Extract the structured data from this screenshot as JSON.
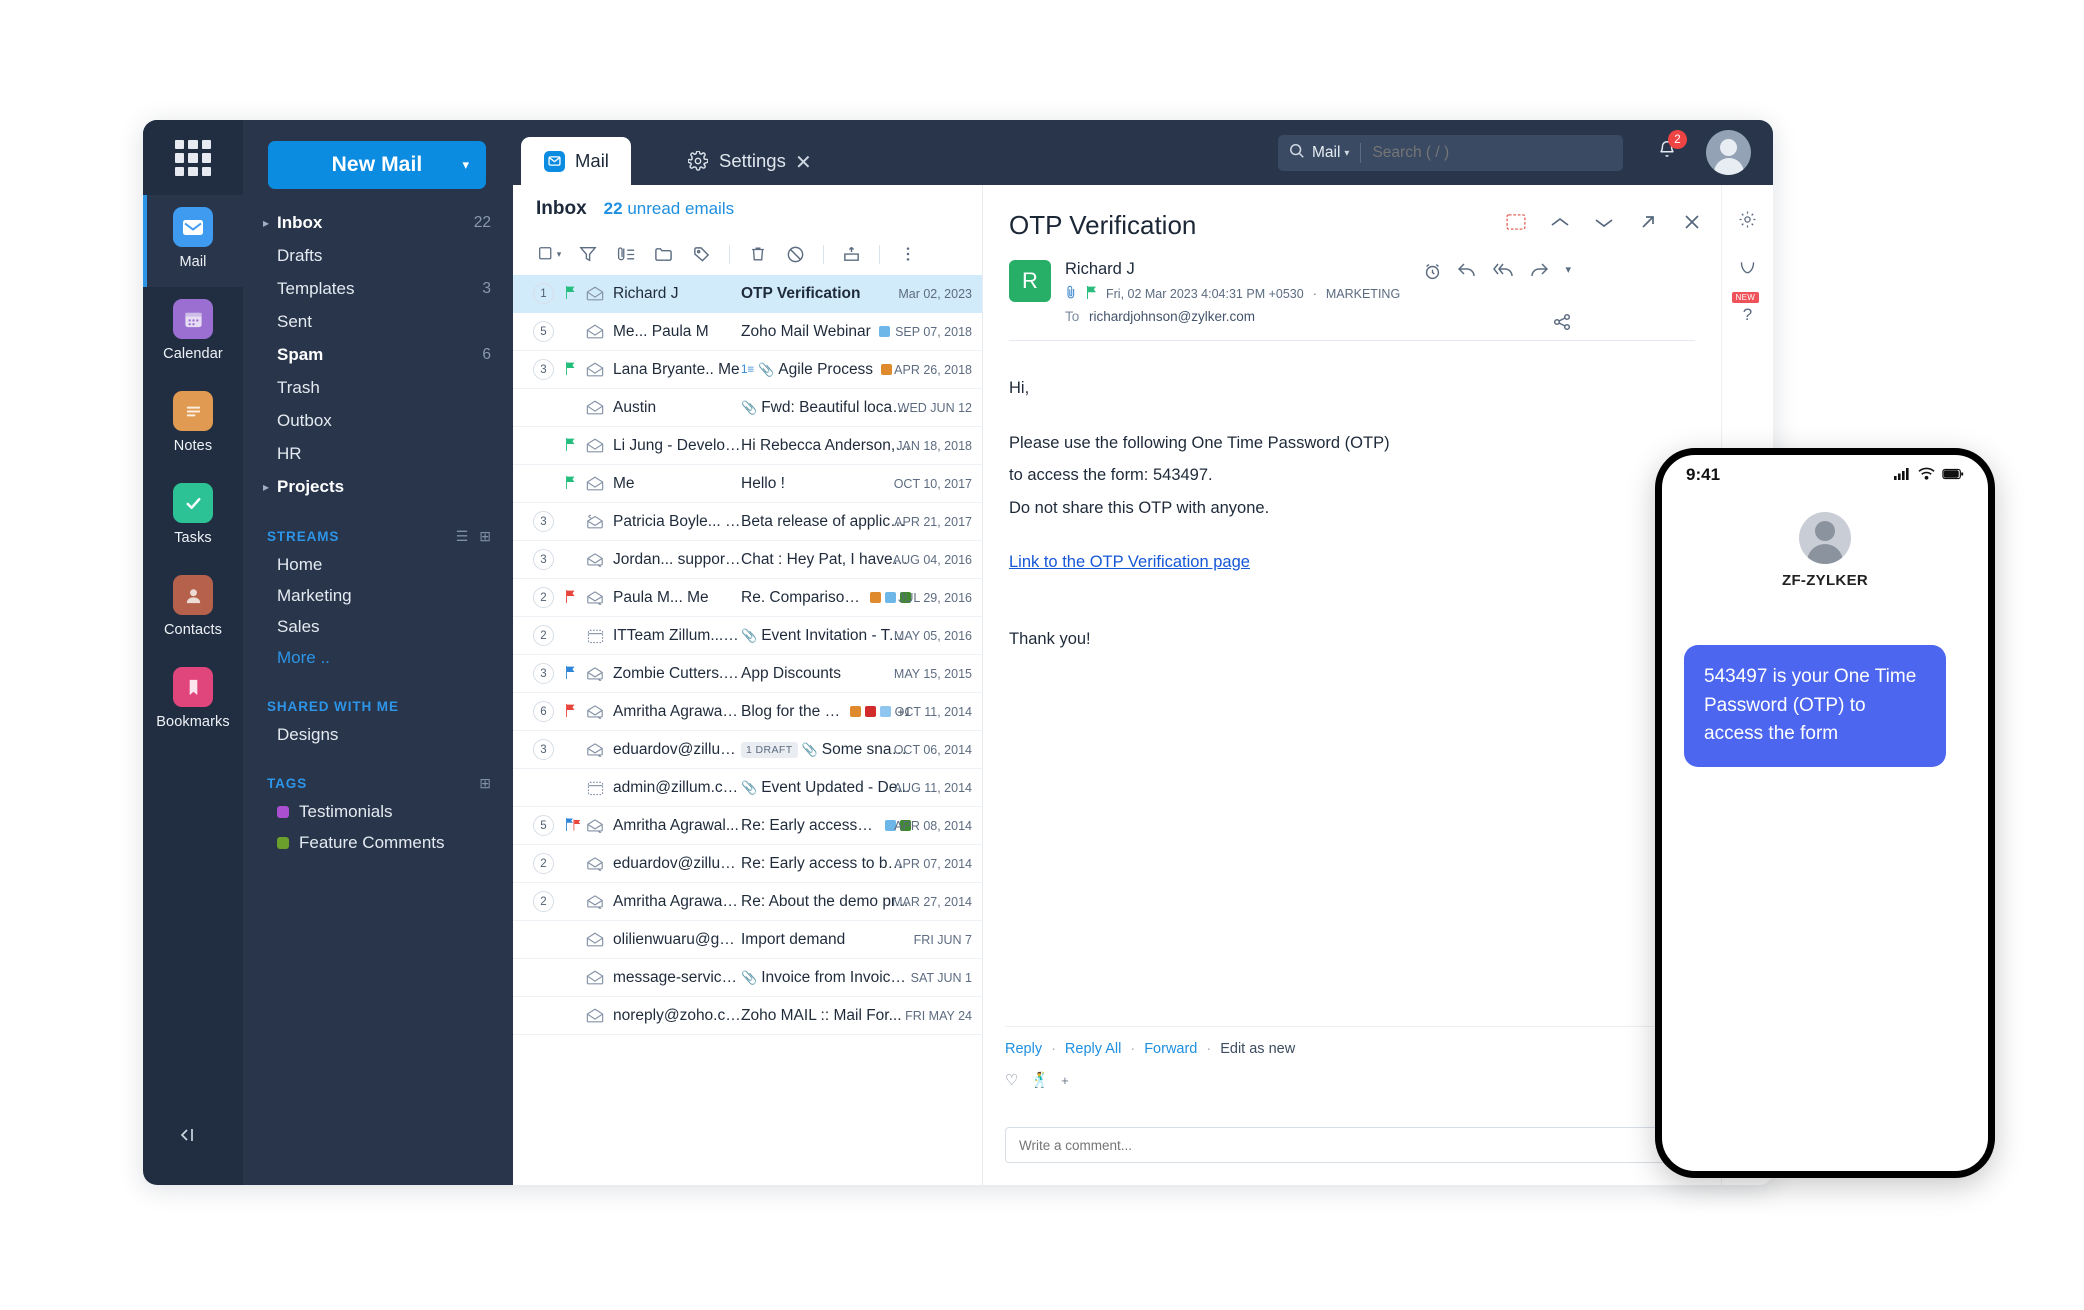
{
  "rail": {
    "grid_icon": "apps-grid-icon",
    "items": [
      {
        "label": "Mail",
        "icon": "mail-icon",
        "color": "#3e9bf0",
        "active": true
      },
      {
        "label": "Calendar",
        "icon": "calendar-icon",
        "color": "#9b6fd1",
        "active": false
      },
      {
        "label": "Notes",
        "icon": "notes-icon",
        "color": "#e09a52",
        "active": false
      },
      {
        "label": "Tasks",
        "icon": "tasks-check-icon",
        "color": "#2cc295",
        "active": false
      },
      {
        "label": "Contacts",
        "icon": "contacts-icon",
        "color": "#b5614b",
        "active": false
      },
      {
        "label": "Bookmarks",
        "icon": "bookmark-icon",
        "color": "#e0457b",
        "active": false
      }
    ],
    "collapse_icon": "collapse-panel-icon"
  },
  "sidebar": {
    "new_mail_label": "New Mail",
    "new_mail_caret": "chevron-down-icon",
    "folders": [
      {
        "label": "Inbox",
        "count": "22",
        "bold": true,
        "caret": true
      },
      {
        "label": "Drafts",
        "count": "",
        "bold": false,
        "caret": false
      },
      {
        "label": "Templates",
        "count": "3",
        "bold": false,
        "caret": false
      },
      {
        "label": "Sent",
        "count": "",
        "bold": false,
        "caret": false
      },
      {
        "label": "Spam",
        "count": "6",
        "bold": true,
        "caret": false
      },
      {
        "label": "Trash",
        "count": "",
        "bold": false,
        "caret": false
      },
      {
        "label": "Outbox",
        "count": "",
        "bold": false,
        "caret": false
      },
      {
        "label": "HR",
        "count": "",
        "bold": false,
        "caret": false
      },
      {
        "label": "Projects",
        "count": "",
        "bold": true,
        "caret": true
      }
    ],
    "streams_title": "STREAMS",
    "streams": [
      {
        "label": "Home",
        "link": false
      },
      {
        "label": "Marketing",
        "link": false
      },
      {
        "label": "Sales",
        "link": false
      },
      {
        "label": "More ..",
        "link": true
      }
    ],
    "shared_title": "SHARED WITH ME",
    "shared": [
      {
        "label": "Designs",
        "link": false
      }
    ],
    "tags_title": "TAGS",
    "tags": [
      {
        "label": "Testimonials",
        "color": "#a94fd0"
      },
      {
        "label": "Feature Comments",
        "color": "#6aa02b"
      }
    ]
  },
  "tabs": {
    "mail": {
      "label": "Mail",
      "icon": "mail-icon"
    },
    "settings": {
      "label": "Settings",
      "icon": "gear-icon"
    },
    "close_icon": "close-icon"
  },
  "search": {
    "scope": "Mail",
    "scope_caret": "chevron-down-icon",
    "placeholder": "Search ( / )",
    "value": "",
    "icon": "search-icon"
  },
  "header": {
    "bell_icon": "bell-icon",
    "notification_count": "2",
    "avatar": "user-avatar"
  },
  "list": {
    "folder_title": "Inbox",
    "unread_count": "22",
    "unread_label": "unread emails",
    "tools": [
      "select-all-checkbox",
      "filter-icon",
      "attachment-sort-icon",
      "folder-icon",
      "tag-icon",
      "delete-icon",
      "block-icon",
      "archive-icon",
      "more-options-icon"
    ],
    "rows": [
      {
        "count": "1",
        "flag": "green",
        "env": "open-envelope-icon",
        "from": "Richard J",
        "subject": "OTP Verification",
        "date": "Mar 02, 2023",
        "selected": true,
        "bold": true,
        "clip": false,
        "chips": [],
        "thread": "",
        "draft": ""
      },
      {
        "count": "5",
        "flag": "",
        "env": "open-envelope-icon",
        "from": "Me... Paula M",
        "subject": "Zoho Mail Webinar",
        "date": "SEP 07, 2018",
        "selected": false,
        "bold": false,
        "clip": false,
        "chips": [
          "#6cb6e8"
        ],
        "thread": "",
        "draft": ""
      },
      {
        "count": "3",
        "flag": "green",
        "env": "open-envelope-icon",
        "from": "Lana Bryante.. Me",
        "subject": "Agile Process",
        "date": "APR 26, 2018",
        "selected": false,
        "bold": false,
        "clip": true,
        "chips": [
          "#e08a2e"
        ],
        "thread": "1",
        "draft": ""
      },
      {
        "count": "",
        "flag": "",
        "env": "open-envelope-icon",
        "from": "Austin",
        "subject": "Fwd: Beautiful locati...",
        "date": "WED JUN 12",
        "selected": false,
        "bold": false,
        "clip": true,
        "chips": [],
        "thread": "",
        "draft": ""
      },
      {
        "count": "",
        "flag": "green",
        "env": "open-envelope-icon",
        "from": "Li Jung - Developer",
        "subject": "Hi Rebecca Anderson, ...",
        "date": "JAN 18, 2018",
        "selected": false,
        "bold": false,
        "clip": false,
        "chips": [],
        "thread": "",
        "draft": ""
      },
      {
        "count": "",
        "flag": "green",
        "env": "open-envelope-icon",
        "from": "Me",
        "subject": "Hello !",
        "date": "OCT 10, 2017",
        "selected": false,
        "bold": false,
        "clip": false,
        "chips": [],
        "thread": "",
        "draft": ""
      },
      {
        "count": "3",
        "flag": "",
        "env": "replied-envelope-icon",
        "from": "Patricia Boyle... Me",
        "subject": "Beta release of applica...",
        "date": "APR 21, 2017",
        "selected": false,
        "bold": false,
        "clip": false,
        "chips": [],
        "thread": "",
        "draft": ""
      },
      {
        "count": "3",
        "flag": "",
        "env": "forwarded-envelope-icon",
        "from": "Jordan... support@z...",
        "subject": "Chat : Hey Pat, I have f...",
        "date": "AUG 04, 2016",
        "selected": false,
        "bold": false,
        "clip": false,
        "chips": [],
        "thread": "",
        "draft": ""
      },
      {
        "count": "2",
        "flag": "red",
        "env": "forwarded-envelope-icon",
        "from": "Paula M... Me",
        "subject": "Re. Comparison ...",
        "date": "JUL 29, 2016",
        "selected": false,
        "bold": false,
        "clip": false,
        "chips": [
          "#e08a2e",
          "#6cb6e8",
          "#3f8a2e"
        ],
        "thread": "",
        "draft": ""
      },
      {
        "count": "2",
        "flag": "",
        "env": "calendar-envelope-icon",
        "from": "ITTeam Zillum... Me",
        "subject": "Event Invitation - Tea...",
        "date": "MAY 05, 2016",
        "selected": false,
        "bold": false,
        "clip": true,
        "chips": [],
        "thread": "",
        "draft": ""
      },
      {
        "count": "3",
        "flag": "blue",
        "env": "forwarded-envelope-icon",
        "from": "Zombie Cutters... le...",
        "subject": "App Discounts",
        "date": "MAY 15, 2015",
        "selected": false,
        "bold": false,
        "clip": false,
        "chips": [],
        "thread": "",
        "draft": ""
      },
      {
        "count": "6",
        "flag": "red",
        "env": "forwarded-envelope-icon",
        "from": "Amritha Agrawal... ...",
        "subject": "Blog for the Be...",
        "date": "OCT 11, 2014",
        "selected": false,
        "bold": false,
        "clip": false,
        "chips": [
          "#e08a2e",
          "#d22b2b",
          "#8fc6f0"
        ],
        "plus": "+1",
        "thread": "",
        "draft": ""
      },
      {
        "count": "3",
        "flag": "",
        "env": "forwarded-envelope-icon",
        "from": "eduardov@zillum.c...",
        "subject": "Some snaps f...",
        "date": "OCT 06, 2014",
        "selected": false,
        "bold": false,
        "clip": true,
        "chips": [],
        "thread": "",
        "draft": "1 DRAFT"
      },
      {
        "count": "",
        "flag": "",
        "env": "calendar-envelope-icon",
        "from": "admin@zillum.com",
        "subject": "Event Updated - De...",
        "date": "AUG 11, 2014",
        "selected": false,
        "bold": false,
        "clip": true,
        "chips": [],
        "thread": "",
        "draft": ""
      },
      {
        "count": "5",
        "flag": "multi",
        "env": "forwarded-envelope-icon",
        "from": "Amritha Agrawal...",
        "subject": "Re: Early access to ...",
        "date": "APR 08, 2014",
        "selected": false,
        "bold": false,
        "clip": false,
        "chips": [
          "#6cb6e8",
          "#3f8a2e"
        ],
        "thread": "",
        "draft": ""
      },
      {
        "count": "2",
        "flag": "",
        "env": "forwarded-envelope-icon",
        "from": "eduardov@zillum.c...",
        "subject": "Re: Early access to bet...",
        "date": "APR 07, 2014",
        "selected": false,
        "bold": false,
        "clip": false,
        "chips": [],
        "thread": "",
        "draft": ""
      },
      {
        "count": "2",
        "flag": "",
        "env": "forwarded-envelope-icon",
        "from": "Amritha Agrawal. ...",
        "subject": "Re: About the demo pr...",
        "date": "MAR 27, 2014",
        "selected": false,
        "bold": false,
        "clip": false,
        "chips": [],
        "thread": "",
        "draft": ""
      },
      {
        "count": "",
        "flag": "",
        "env": "open-envelope-icon",
        "from": "olilienwuaru@gmai...",
        "subject": "Import demand",
        "date": "FRI JUN 7",
        "selected": false,
        "bold": false,
        "clip": false,
        "chips": [],
        "thread": "",
        "draft": ""
      },
      {
        "count": "",
        "flag": "",
        "env": "open-envelope-icon",
        "from": "message-service@...",
        "subject": "Invoice from Invoice ...",
        "date": "SAT JUN 1",
        "selected": false,
        "bold": false,
        "clip": true,
        "chips": [],
        "thread": "",
        "draft": ""
      },
      {
        "count": "",
        "flag": "",
        "env": "open-envelope-icon",
        "from": "noreply@zoho.com",
        "subject": "Zoho MAIL :: Mail For...",
        "date": "FRI MAY 24",
        "selected": false,
        "bold": false,
        "clip": false,
        "chips": [],
        "thread": "",
        "draft": ""
      }
    ]
  },
  "reading": {
    "title": "OTP Verification",
    "actions": [
      "translate-icon",
      "previous-message-icon",
      "next-message-icon",
      "open-in-new-icon",
      "close-icon"
    ],
    "sender_initial": "R",
    "sender_name": "Richard J",
    "attachment_icon": "attachment-icon",
    "flag_icon": "flag-icon",
    "datetime": "Fri, 02 Mar 2023 4:04:31 PM +0530",
    "label": "MARKETING",
    "to_label": "To",
    "to_address": "richardjohnson@zylker.com",
    "message_actions": [
      "snooze-icon",
      "reply-icon",
      "reply-all-icon",
      "forward-icon",
      "more-caret-icon"
    ],
    "share_icon": "share-icon",
    "body": {
      "greeting": "Hi,",
      "line1": "Please use the following One Time Password (OTP)",
      "line2": "to access the form: 543497.",
      "line3": "Do not share this OTP with anyone.",
      "link": "Link to the OTP Verification page",
      "closing": "Thank you!"
    },
    "reply_bar": {
      "reply": "Reply",
      "reply_all": "Reply All",
      "forward": "Forward",
      "edit_as_new": "Edit as new",
      "separator": "·"
    },
    "reactions": [
      "heart-reaction-icon",
      "dance-reaction-icon",
      "add-reaction-icon"
    ],
    "comment_placeholder": "Write a comment...",
    "comment_value": ""
  },
  "right_rail": [
    {
      "icon": "gear-icon",
      "badge": ""
    },
    {
      "icon": "zia-icon",
      "badge": ""
    },
    {
      "icon": "help-icon",
      "badge": "NEW"
    }
  ],
  "phone": {
    "time": "9:41",
    "status_icons": [
      "signal-icon",
      "wifi-icon",
      "battery-icon"
    ],
    "avatar": "contact-avatar",
    "contact_name": "ZF-ZYLKER",
    "message": "543497 is your One Time Password (OTP) to access the form",
    "bubble_color": "#4d66ef"
  }
}
